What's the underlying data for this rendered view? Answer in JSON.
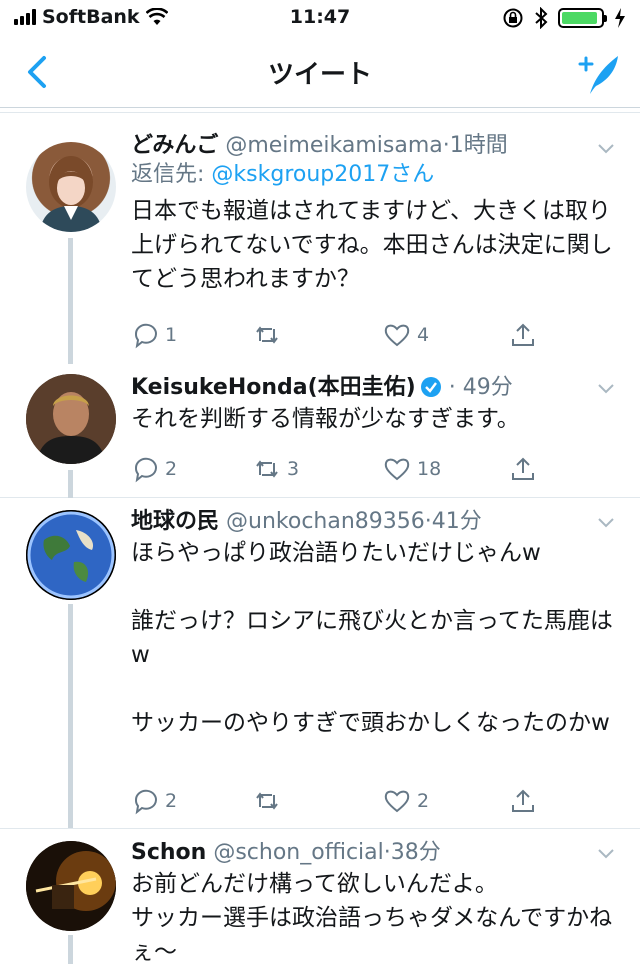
{
  "status": {
    "carrier": "SoftBank",
    "time": "11:47",
    "battery_level": 0.92
  },
  "nav": {
    "title": "ツイート"
  },
  "tweets": [
    {
      "name": "どみんご",
      "handle": "@meimeikamisama",
      "time": "1時間",
      "reply_prefix": "返信先:",
      "reply_to": "@kskgroup2017さん",
      "text": "日本でも報道はされてますけど、大きくは取り上げられてないですね。本田さんは決定に関してどう思われますか？",
      "replies": "1",
      "retweets": "",
      "likes": "4"
    },
    {
      "name": "KeisukeHonda(本田圭佑)",
      "handle": "",
      "time": "49分",
      "text": "それを判断する情報が少なすぎます。",
      "replies": "2",
      "retweets": "3",
      "likes": "18"
    },
    {
      "name": "地球の民",
      "handle": "@unkochan89356",
      "time": "41分",
      "text": "ほらやっぱり政治語りたいだけじゃんw\n\n誰だっけ？ロシアに飛び火とか言ってた馬鹿はw\n\nサッカーのやりすぎで頭おかしくなったのかw",
      "replies": "2",
      "retweets": "",
      "likes": "2"
    },
    {
      "name": "Schon",
      "handle": "@schon_official",
      "time": "38分",
      "text": "お前どんだけ構って欲しいんだよ。\nサッカー選手は政治語っちゃダメなんですかねぇ〜",
      "replies": "",
      "retweets": "",
      "likes": ""
    }
  ],
  "colors": {
    "accent": "#1da1f2",
    "muted": "#657786",
    "thread": "#ccd6dd"
  }
}
